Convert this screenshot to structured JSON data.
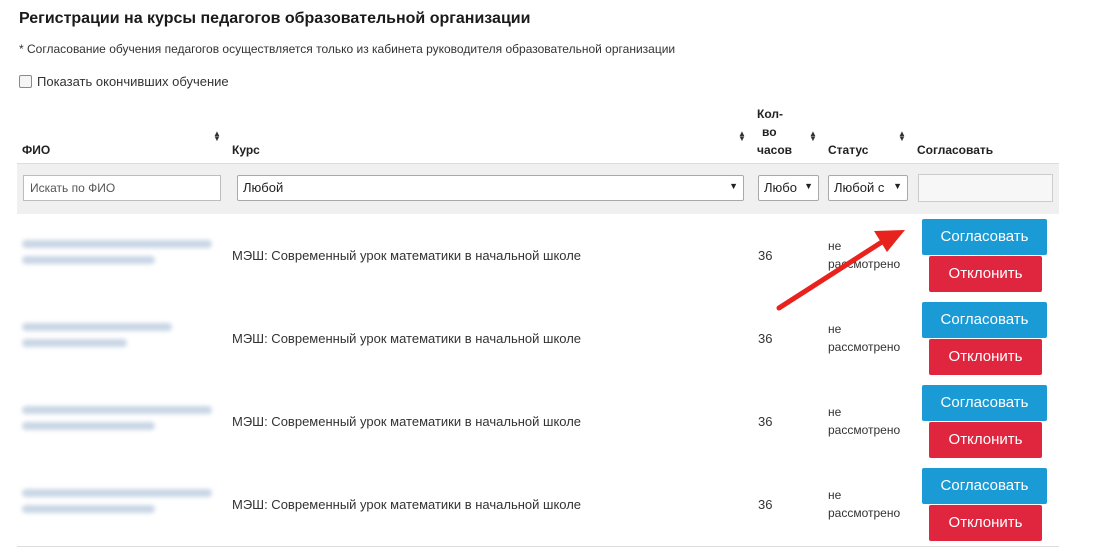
{
  "page": {
    "title": "Регистрации на курсы педагогов образовательной организации",
    "note": "* Согласование обучения педагогов осуществляется только из кабинета руководителя образовательной организации",
    "show_finished_label": "Показать окончивших обучение"
  },
  "table": {
    "headers": {
      "fio": "ФИО",
      "course": "Курс",
      "hours_1": "Кол-",
      "hours_2": "во",
      "hours_3": "часов",
      "status": "Статус",
      "approve": "Согласовать"
    },
    "filters": {
      "fio_placeholder": "Искать по ФИО",
      "course_value": "Любой",
      "hours_value": "Любо",
      "status_value": "Любой с",
      "approve_value": ""
    },
    "rows": [
      {
        "course": "МЭШ: Современный урок математики в начальной школе",
        "hours": "36",
        "status_1": "не",
        "status_2": "рассмотрено",
        "approve_label": "Согласовать",
        "reject_label": "Отклонить"
      },
      {
        "course": "МЭШ: Современный урок математики в начальной школе",
        "hours": "36",
        "status_1": "не",
        "status_2": "рассмотрено",
        "approve_label": "Согласовать",
        "reject_label": "Отклонить"
      },
      {
        "course": "МЭШ: Современный урок математики в начальной школе",
        "hours": "36",
        "status_1": "не",
        "status_2": "рассмотрено",
        "approve_label": "Согласовать",
        "reject_label": "Отклонить"
      },
      {
        "course": "МЭШ: Современный урок математики в начальной школе",
        "hours": "36",
        "status_1": "не",
        "status_2": "рассмотрено",
        "approve_label": "Согласовать",
        "reject_label": "Отклонить"
      }
    ]
  },
  "colors": {
    "approve": "#1b9bd6",
    "reject": "#e0263e",
    "annotation_arrow": "#e8221c"
  },
  "icons": [
    "sort-icon",
    "chevron-down-icon",
    "checkbox-icon",
    "annotation-arrow-icon"
  ]
}
